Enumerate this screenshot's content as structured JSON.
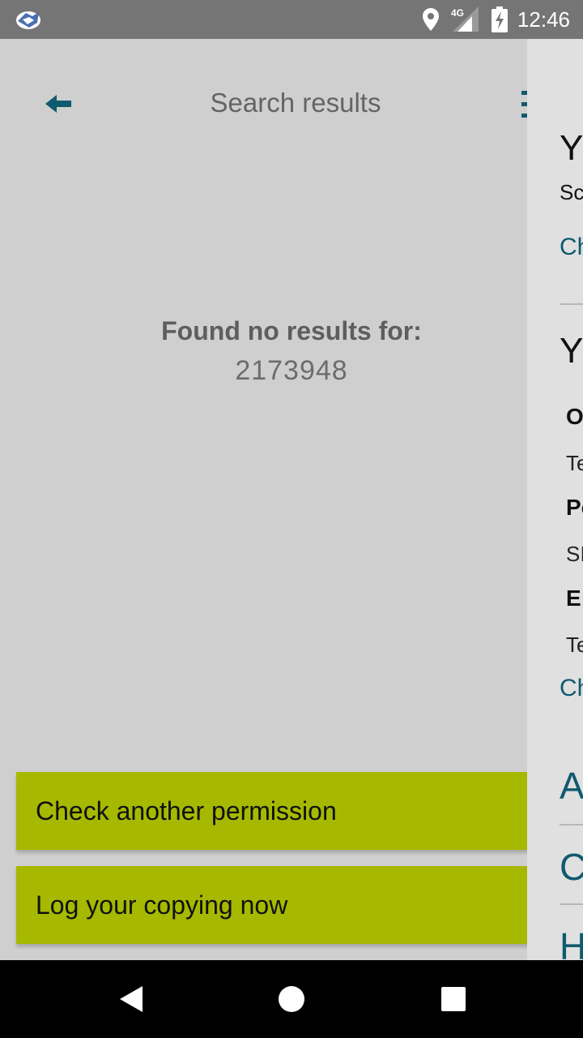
{
  "status_bar": {
    "time": "12:46",
    "network": "4G",
    "icons": [
      "app-notification-icon",
      "location-icon",
      "signal-4g-icon",
      "battery-charging-icon"
    ]
  },
  "header": {
    "title": "Search results",
    "back_icon": "arrow-left-icon",
    "menu_icon": "more-vertical-icon"
  },
  "results": {
    "empty_label": "Found no results for:",
    "query": "2173948"
  },
  "actions": {
    "check_another": "Check another permission",
    "log_copying": "Log your copying now"
  },
  "drawer": {
    "heading_1": "Y",
    "sub_1": "Sc",
    "link_1": "Ch",
    "heading_2": "Y",
    "field_1_label": "O",
    "field_1_value": "Te",
    "field_2_label": "Po",
    "field_2_value": "SI",
    "field_3_label": "E",
    "field_3_value": "Te",
    "link_2": "Ch",
    "menu_item_1": "A",
    "menu_item_2": "C",
    "menu_item_3": "H"
  },
  "colors": {
    "accent_button": "#a6b900",
    "teal": "#0f5a6e",
    "status_bar": "#757575",
    "overlay_bg": "#cfcfcf",
    "drawer_bg": "#e0e0e0"
  },
  "nav_bar": {
    "icons": [
      "back-triangle-icon",
      "home-circle-icon",
      "recents-square-icon"
    ]
  }
}
